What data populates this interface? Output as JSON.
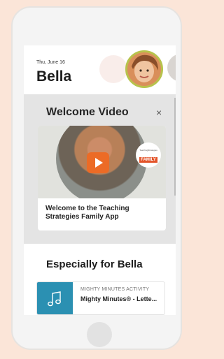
{
  "header": {
    "date": "Thu, June 16",
    "name": "Bella"
  },
  "welcome": {
    "title": "Welcome Video",
    "close_icon": "×",
    "video_title": "Welcome to the Teaching Strategies Family App",
    "badge_top": "TeachingStrategies",
    "badge_main": "FAMILY"
  },
  "section": {
    "title": "Especially for Bella"
  },
  "activity": {
    "type": "MIGHTY MINUTES ACTIVITY",
    "name": "Mighty Minutes® - Lette..."
  },
  "colors": {
    "accent": "#ec6b26",
    "tile": "#2b90b2",
    "avatar_ring": "#b7c24c"
  }
}
